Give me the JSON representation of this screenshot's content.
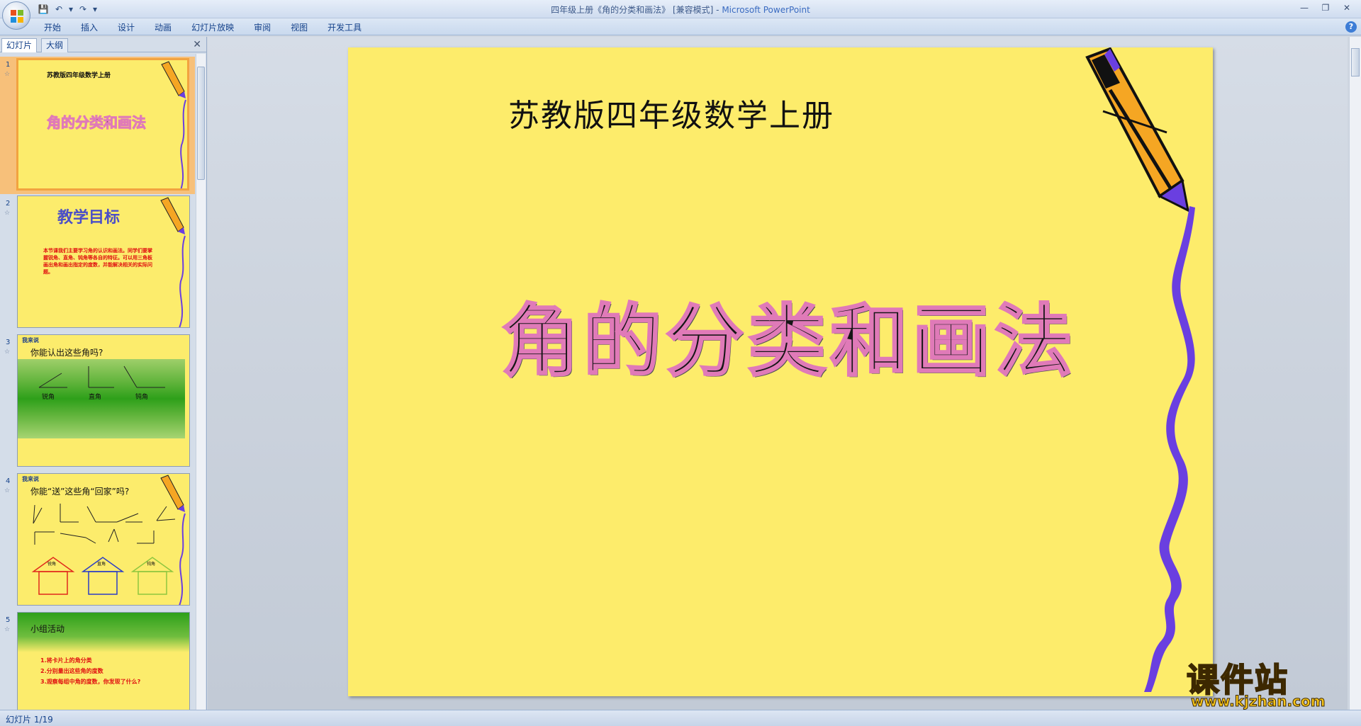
{
  "window": {
    "title_doc": "四年级上册《角的分类和画法》 [兼容模式] - ",
    "title_app": "Microsoft PowerPoint"
  },
  "qat": {
    "save": "💾",
    "undo": "↶",
    "undo_drop": "▾",
    "redo": "↷",
    "customize": "▾"
  },
  "win_controls": {
    "minimize": "—",
    "restore": "❐",
    "close": "✕"
  },
  "ribbon": {
    "tabs": [
      "开始",
      "插入",
      "设计",
      "动画",
      "幻灯片放映",
      "审阅",
      "视图",
      "开发工具"
    ],
    "help": "?"
  },
  "left_pane": {
    "tab_slides": "幻灯片",
    "tab_outline": "大纲",
    "close": "✕",
    "slides": [
      {
        "num": "1",
        "title": "苏教版四年级数学上册",
        "heading": "角的分类和画法"
      },
      {
        "num": "2",
        "heading": "教学目标",
        "body": "本节课我们主要学习角的认识和画法。同学们要掌握锐角、直角、钝角等各自的特征。可以用三角板画出角和画出指定的度数，并能解决相关的实际问题。"
      },
      {
        "num": "3",
        "badge": "我来说",
        "question": "你能认出这些角吗?",
        "labels": [
          "锐角",
          "直角",
          "钝角"
        ]
      },
      {
        "num": "4",
        "badge": "我来说",
        "question": "你能“送”这些角“回家”吗?",
        "houses": [
          "锐角",
          "直角",
          "钝角"
        ]
      },
      {
        "num": "5",
        "heading": "小组活动",
        "items": [
          "1.将卡片上的角分类",
          "2.分别量出这些角的度数",
          "3.观察每组中角的度数，你发现了什么?"
        ]
      }
    ]
  },
  "slide": {
    "subtitle": "苏教版四年级数学上册",
    "title": "角的分类和画法"
  },
  "watermark": {
    "cn": "课件站",
    "url": "www.kjzhan.com"
  },
  "status": {
    "text": "幻灯片 1/19"
  },
  "colors": {
    "slide_bg": "#fdec6b",
    "selected_thumb": "#f2a340",
    "pencil_body": "#f5a623",
    "pencil_tip": "#6a3fe0"
  }
}
